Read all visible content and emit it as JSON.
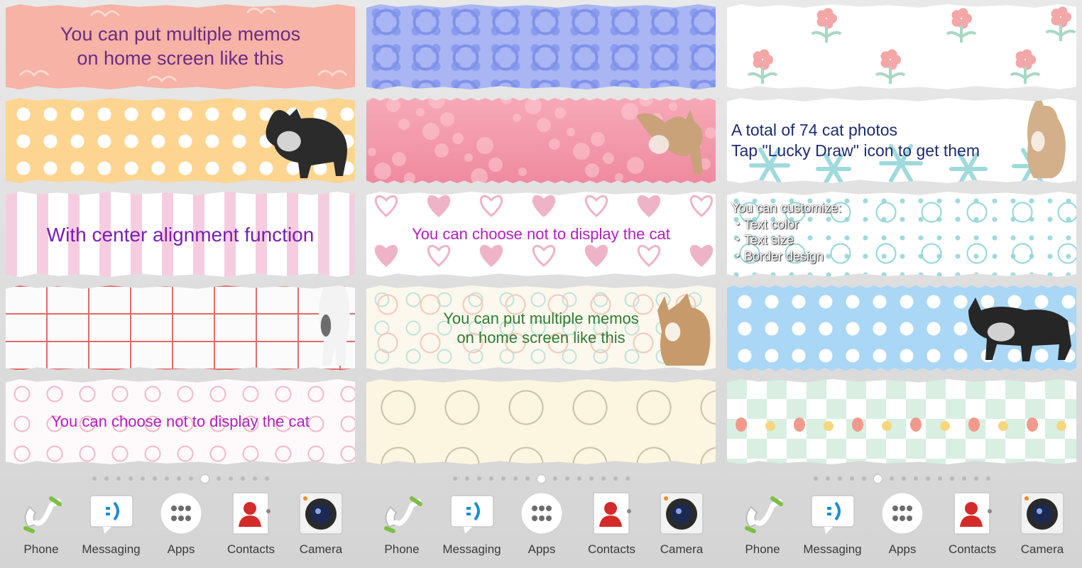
{
  "colors": {
    "text_purple": "#6a2c86",
    "text_violet": "#7a1fb5",
    "text_magenta": "#b21fc2",
    "text_green": "#2e7d32",
    "text_navy": "#1f2c6e",
    "text_white": "#ffffff"
  },
  "screens": [
    {
      "memos": [
        {
          "pattern": "bg-pink-love",
          "text": "You can put multiple memos\non home screen like this",
          "color": "#6a2c86",
          "size": 27,
          "align": "center",
          "edge": "torn-top"
        },
        {
          "pattern": "bg-yellow-dots",
          "text": "",
          "color": "#6a2c86",
          "size": 24,
          "align": "center",
          "edge": "torn-top",
          "cat": "cat-photo-black-white"
        },
        {
          "pattern": "bg-pink-stripes",
          "text": "With center alignment function",
          "color": "#7a1fb5",
          "size": 28,
          "align": "center",
          "edge": "torn-top"
        },
        {
          "pattern": "bg-red-grid",
          "text": "",
          "color": "#6a2c86",
          "size": 24,
          "align": "center",
          "edge": "torn-top",
          "cat": "cat-photo-standing"
        },
        {
          "pattern": "bg-pink-floral",
          "text": "You can choose not to display the cat",
          "color": "#b21fc2",
          "size": 22,
          "align": "center",
          "edge": "torn-top"
        }
      ],
      "active_page": 9
    },
    {
      "memos": [
        {
          "pattern": "bg-blue-damask",
          "text": "",
          "color": "#6a2c86",
          "size": 24,
          "align": "center",
          "edge": "torn-top"
        },
        {
          "pattern": "bg-pink-stars",
          "text": "",
          "color": "#6a2c86",
          "size": 24,
          "align": "center",
          "edge": "wavy",
          "cat": "cat-photo-jumping"
        },
        {
          "pattern": "bg-hearts",
          "text": "You can choose not to display the cat",
          "color": "#b21fc2",
          "size": 22,
          "align": "center",
          "edge": "torn-top"
        },
        {
          "pattern": "bg-pastel-floral",
          "text": "You can put multiple memos\non home screen like this",
          "color": "#2e7d32",
          "size": 22,
          "align": "center",
          "edge": "torn-top",
          "cat": "cat-photo-waving"
        },
        {
          "pattern": "bg-cream-floral",
          "text": "",
          "color": "#6a2c86",
          "size": 24,
          "align": "center",
          "edge": "torn-top"
        }
      ],
      "active_page": 7
    },
    {
      "memos": [
        {
          "pattern": "bg-white-flower",
          "text": "",
          "color": "#6a2c86",
          "size": 24,
          "align": "center",
          "edge": "torn-top"
        },
        {
          "pattern": "bg-snowflake",
          "text": "A total of 74 cat photos\nTap \"Lucky Draw\" icon to get them",
          "color": "#1f2c6e",
          "size": 23,
          "align": "left",
          "edge": "torn-top",
          "cat": "cat-photo-sitting"
        },
        {
          "pattern": "bg-aqua-floral",
          "text": "You can customize:\n・Text color\n・Text size\n・Border design",
          "color": "#ffffff",
          "size": 18,
          "align": "topleft",
          "edge": "torn-top"
        },
        {
          "pattern": "bg-blue-dots",
          "text": "",
          "color": "#6a2c86",
          "size": 24,
          "align": "center",
          "edge": "wavy",
          "cat": "cat-photo-walking"
        },
        {
          "pattern": "bg-mint-diamond",
          "text": "",
          "color": "#6a2c86",
          "size": 24,
          "align": "center",
          "edge": "torn-top"
        }
      ],
      "active_page": 5
    }
  ],
  "page_dot_count": 15,
  "dock": [
    {
      "label": "Phone",
      "icon": "phone-icon"
    },
    {
      "label": "Messaging",
      "icon": "messaging-icon"
    },
    {
      "label": "Apps",
      "icon": "apps-icon"
    },
    {
      "label": "Contacts",
      "icon": "contacts-icon"
    },
    {
      "label": "Camera",
      "icon": "camera-icon"
    }
  ]
}
